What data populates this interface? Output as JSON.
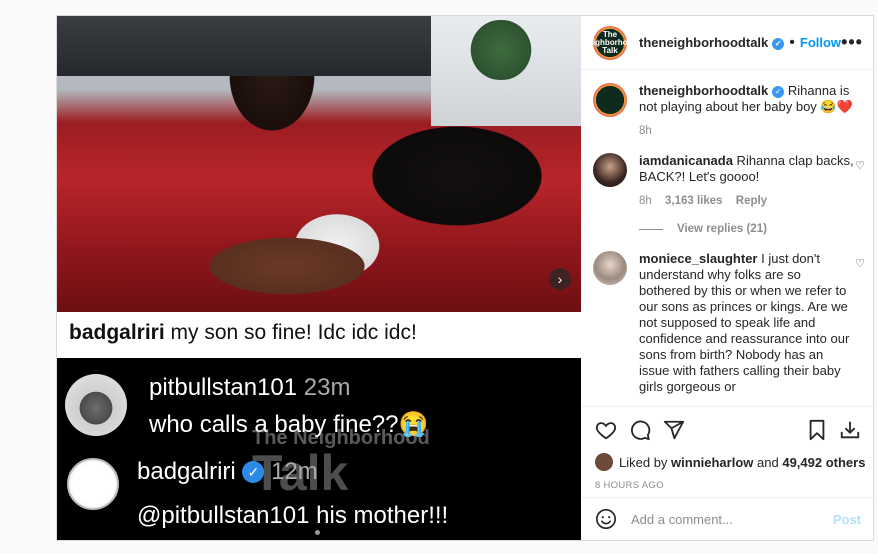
{
  "header": {
    "avatar_text": "The Neighborhood Talk",
    "username": "theneighborhoodtalk",
    "follow_label": "Follow",
    "more_label": "•••"
  },
  "media": {
    "caption_user": "badgalriri",
    "caption_text": " my son so fine! Idc idc idc!",
    "tweet1_handle": "pitbullstan101",
    "tweet1_time": " 23m",
    "tweet1_text": "who calls a baby fine??😭",
    "tweet2_handle": "badgalriri",
    "tweet2_time": "12m",
    "tweet2_text": "@pitbullstan101 his mother!!!",
    "watermark_top": "The Neighborhood",
    "watermark_big": "Talk",
    "next_label": "›"
  },
  "caption": {
    "username": "theneighborhoodtalk",
    "text": " Rihanna is not playing about her baby boy 😂❤️",
    "time": "8h"
  },
  "comments": [
    {
      "username": "iamdanicanada",
      "text": " Rihanna clap backs, BACK?! Let's goooo!",
      "time": "8h",
      "likes": "3,163 likes",
      "reply": "Reply"
    },
    {
      "username": "moniece_slaughter",
      "text": " I just don't understand why folks are so bothered by this or when we refer to our sons as princes or kings. Are we not supposed to speak life and confidence and reassurance into our sons from birth? Nobody has an issue with fathers calling their baby girls gorgeous or"
    }
  ],
  "view_replies": "View replies (21)",
  "actions": {
    "liked_by_prefix": "Liked by ",
    "liked_by_user": "winnieharlow",
    "liked_by_and": " and ",
    "liked_by_count": "49,492 others",
    "timestamp": "8 HOURS AGO"
  },
  "add_comment": {
    "placeholder": "Add a comment...",
    "post_label": "Post"
  },
  "icons": {
    "like": "heart-icon",
    "comment": "comment-icon",
    "share": "send-icon",
    "save": "bookmark-icon",
    "download": "download-icon",
    "emoji": "smile-icon"
  },
  "colors": {
    "link_blue": "#0095f6",
    "verified_blue": "#3897f0",
    "muted_gray": "#8e8e8e"
  }
}
